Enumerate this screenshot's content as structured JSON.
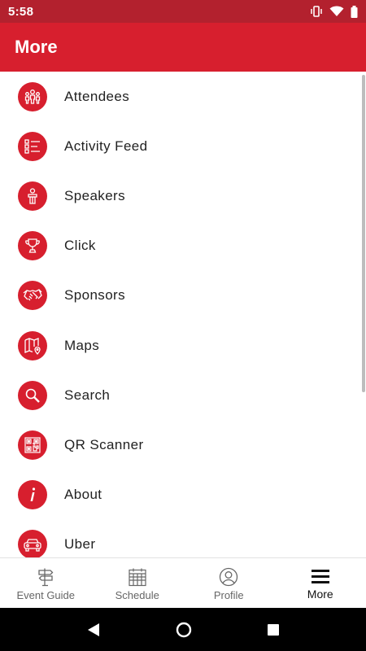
{
  "status_bar": {
    "time": "5:58",
    "icons": [
      "vibrate-icon",
      "wifi-icon",
      "battery-icon"
    ]
  },
  "app_bar": {
    "title": "More"
  },
  "menu": {
    "items": [
      {
        "label": "Attendees",
        "icon": "attendees-icon"
      },
      {
        "label": "Activity Feed",
        "icon": "activity-feed-icon"
      },
      {
        "label": "Speakers",
        "icon": "speaker-icon"
      },
      {
        "label": "Click",
        "icon": "trophy-icon"
      },
      {
        "label": "Sponsors",
        "icon": "handshake-icon"
      },
      {
        "label": "Maps",
        "icon": "map-icon"
      },
      {
        "label": "Search",
        "icon": "search-icon"
      },
      {
        "label": "QR Scanner",
        "icon": "qr-code-icon"
      },
      {
        "label": "About",
        "icon": "info-icon"
      },
      {
        "label": "Uber",
        "icon": "car-icon"
      }
    ]
  },
  "bottom_nav": {
    "items": [
      {
        "label": "Event Guide",
        "icon": "signpost-icon"
      },
      {
        "label": "Schedule",
        "icon": "calendar-icon"
      },
      {
        "label": "Profile",
        "icon": "profile-icon"
      },
      {
        "label": "More",
        "icon": "hamburger-menu-icon",
        "active": true
      }
    ]
  },
  "system_nav": [
    "back-icon",
    "home-icon",
    "recents-icon"
  ],
  "colors": {
    "accent": "#d71f2e",
    "status_bar": "#b3212e",
    "text": "#222222",
    "nav_inactive": "#666666"
  }
}
